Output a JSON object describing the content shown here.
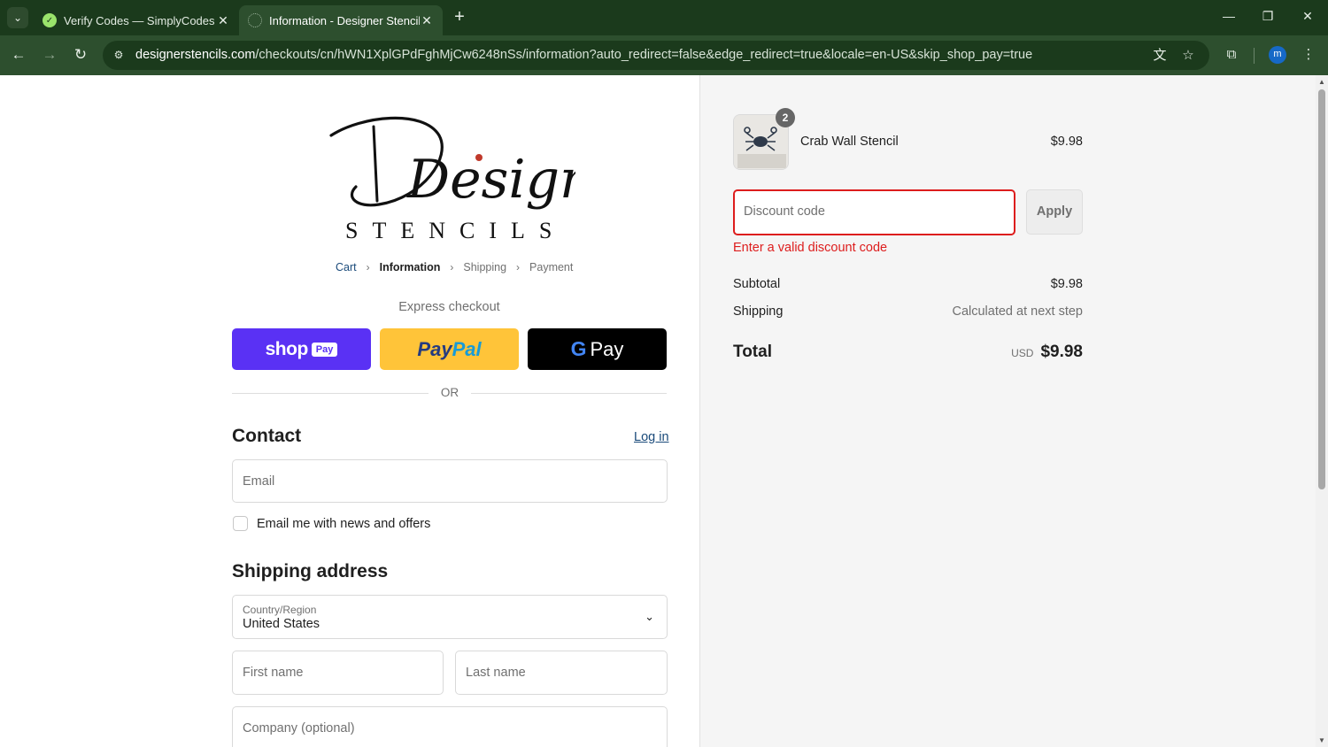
{
  "browser": {
    "tabs": [
      {
        "title": "Verify Codes — SimplyCodes",
        "active": false
      },
      {
        "title": "Information - Designer Stencils",
        "active": true
      }
    ],
    "url_host": "designerstencils.com",
    "url_path": "/checkouts/cn/hWN1XplGPdFghMjCw6248nSs/information?auto_redirect=false&edge_redirect=true&locale=en-US&skip_shop_pay=true",
    "profile_initial": "m",
    "icons": [
      "tab-search-icon",
      "favicon-icon",
      "close-icon",
      "new-tab-icon",
      "minimize-icon",
      "restore-icon",
      "close-window-icon",
      "back-icon",
      "forward-icon",
      "reload-icon",
      "site-info-icon",
      "translate-icon",
      "bookmark-star-icon",
      "extensions-icon",
      "menu-icon"
    ]
  },
  "checkout": {
    "logo_script": "Designer",
    "logo_word": "STENCILS",
    "breadcrumb": [
      "Cart",
      "Information",
      "Shipping",
      "Payment"
    ],
    "express_title": "Express checkout",
    "shop_pay": {
      "word": "shop",
      "badge": "Pay"
    },
    "paypal": {
      "part1": "Pay",
      "part2": "Pal"
    },
    "gpay": {
      "g": "G",
      "word": "Pay"
    },
    "or_text": "OR",
    "contact_title": "Contact",
    "login_label": "Log in",
    "email_placeholder": "Email",
    "news_label": "Email me with news and offers",
    "shipping_title": "Shipping address",
    "country_label": "Country/Region",
    "country_value": "United States",
    "first_name_placeholder": "First name",
    "last_name_placeholder": "Last name",
    "company_placeholder": "Company (optional)"
  },
  "summary": {
    "product_name": "Crab Wall Stencil",
    "product_price": "$9.98",
    "quantity": "2",
    "discount_placeholder": "Discount code",
    "apply_label": "Apply",
    "discount_error": "Enter a valid discount code",
    "subtotal_label": "Subtotal",
    "subtotal_value": "$9.98",
    "shipping_label": "Shipping",
    "shipping_value": "Calculated at next step",
    "total_label": "Total",
    "total_currency": "USD",
    "total_value": "$9.98"
  },
  "colors": {
    "chrome_dark": "#1b3a1c",
    "chrome_toolbar": "#2d4f2e",
    "shop_pay": "#5a31f4",
    "paypal": "#ffc439",
    "error": "#dd1d1d",
    "link": "#1a4a7a"
  }
}
